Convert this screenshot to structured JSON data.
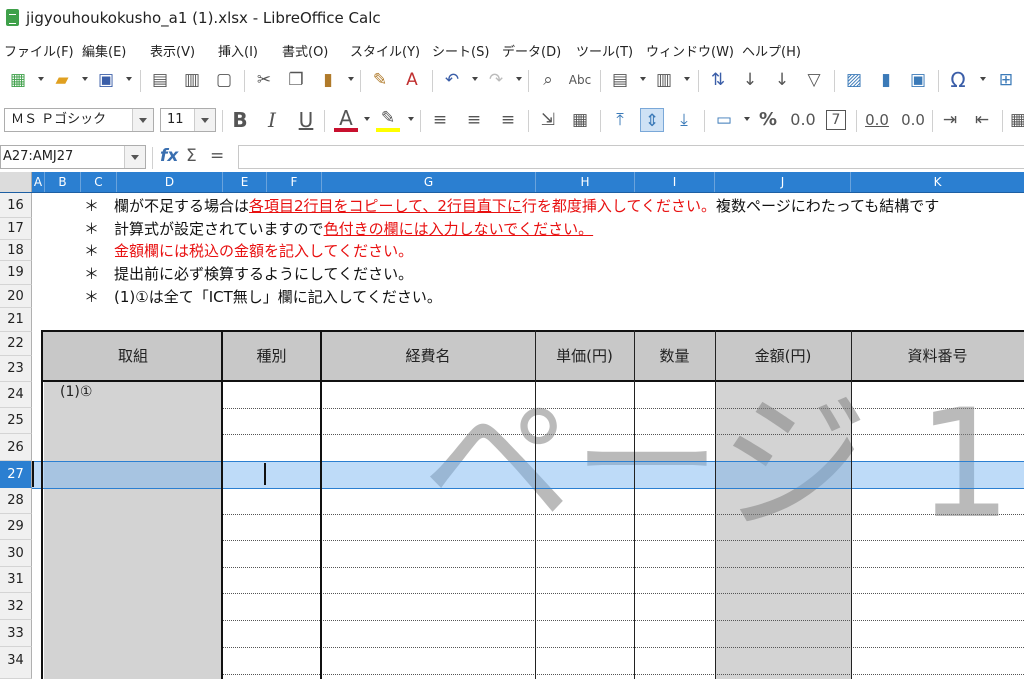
{
  "window": {
    "title": "jigyouhoukokusho_a1 (1).xlsx - LibreOffice Calc"
  },
  "menu": [
    "ファイル(F)",
    "編集(E)",
    "表示(V)",
    "挿入(I)",
    "書式(O)",
    "スタイル(Y)",
    "シート(S)",
    "データ(D)",
    "ツール(T)",
    "ウィンドウ(W)",
    "ヘルプ(H)"
  ],
  "toolbar_standard": {
    "icons": [
      "new-icon",
      "open-icon",
      "save-icon",
      "export-pdf-icon",
      "print-icon",
      "print-preview-icon",
      "cut-icon",
      "copy-icon",
      "paste-icon",
      "clone-formatting-icon",
      "clear-formatting-icon",
      "undo-icon",
      "redo-icon",
      "find-replace-icon",
      "spelling-icon",
      "row-icon",
      "column-icon",
      "sort-icon",
      "sort-ascending-icon",
      "sort-descending-icon",
      "autofilter-icon",
      "image-icon",
      "chart-icon",
      "pivot-table-icon",
      "special-character-icon"
    ]
  },
  "toolbar_format": {
    "font_name": "ＭＳ Ｐゴシック",
    "font_size": "11",
    "number_format_percent": "%",
    "number_format_decimal": "0.0",
    "number_format_7": "7",
    "add_decimal": "0.0",
    "remove_decimal": "0.0"
  },
  "formula_bar": {
    "name_box": "A27:AMJ27",
    "fx": "fx",
    "sum": "Σ",
    "equals": "=",
    "content": ""
  },
  "columns": [
    "A",
    "B",
    "C",
    "D",
    "E",
    "F",
    "G",
    "H",
    "I",
    "J",
    "K"
  ],
  "rows": [
    "16",
    "17",
    "18",
    "19",
    "20",
    "21",
    "22",
    "23",
    "24",
    "25",
    "26",
    "27",
    "28",
    "29",
    "30",
    "31",
    "32",
    "33",
    "34"
  ],
  "selected_row": "27",
  "notes": {
    "line16": {
      "asterisk": "＊",
      "black1": "欄が不足する場合は",
      "red_underline": "各項目2行目をコピーして、2行目直下に",
      "red": "行を都度挿入してください。",
      "black2": "複数ページにわたっても結構です"
    },
    "line17": {
      "asterisk": "＊",
      "black1": "計算式が設定されていますので",
      "red_underline": "色付きの欄には入力しないでください。"
    },
    "line18": {
      "asterisk": "＊",
      "red": "金額欄には税込の金額を記入してください。"
    },
    "line19": {
      "asterisk": "＊",
      "black1": "提出前に必ず検算するようにしてください。"
    },
    "line20": {
      "asterisk": "＊",
      "black1": "(1)①は全て「ICT無し」欄に記入してください。"
    }
  },
  "table": {
    "headers": [
      "取組",
      "種別",
      "経費名",
      "単価(円)",
      "数量",
      "金額(円)",
      "資料番号"
    ],
    "first_cell": "(1)①"
  },
  "watermark": "ページ 1",
  "colors": {
    "selection": "#2b7fd1",
    "header_fill": "#c8c8c8",
    "shaded": "#d3d3d3",
    "red": "#e81010"
  }
}
